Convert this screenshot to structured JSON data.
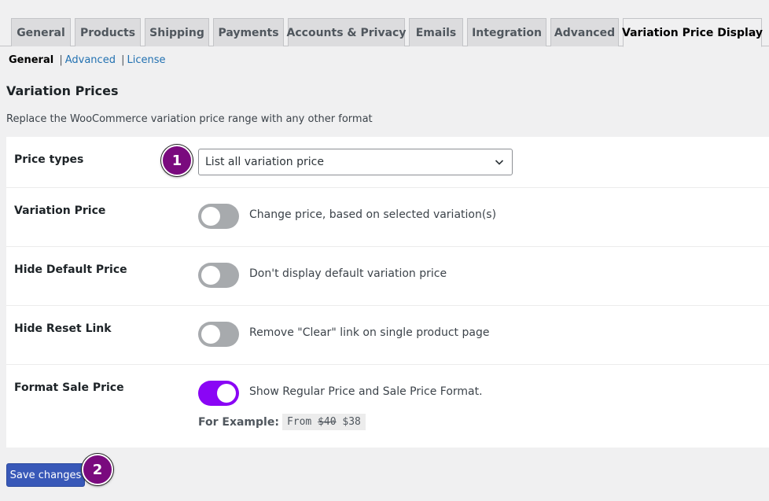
{
  "tabs": [
    {
      "label": "General"
    },
    {
      "label": "Products"
    },
    {
      "label": "Shipping"
    },
    {
      "label": "Payments"
    },
    {
      "label": "Accounts & Privacy"
    },
    {
      "label": "Emails"
    },
    {
      "label": "Integration"
    },
    {
      "label": "Advanced"
    },
    {
      "label": "Variation Price Display",
      "active": true
    }
  ],
  "subnav": {
    "current": "General",
    "sep": "|",
    "links": [
      "Advanced",
      "License"
    ]
  },
  "section": {
    "title": "Variation Prices",
    "description": "Replace the WooCommerce variation price range with any other format"
  },
  "settings": {
    "price_types": {
      "label": "Price types",
      "value": "List all variation price"
    },
    "variation_price": {
      "label": "Variation Price",
      "description": "Change price, based on selected variation(s)",
      "enabled": false
    },
    "hide_default_price": {
      "label": "Hide Default Price",
      "description": "Don't display default variation price",
      "enabled": false
    },
    "hide_reset_link": {
      "label": "Hide Reset Link",
      "description": "Remove \"Clear\" link on single product page",
      "enabled": false
    },
    "format_sale_price": {
      "label": "Format Sale Price",
      "description": "Show Regular Price and Sale Price Format.",
      "enabled": true,
      "example_label": "For Example:",
      "example_prefix": "From",
      "example_regular": "$40",
      "example_sale": "$38"
    }
  },
  "save_button": "Save changes",
  "markers": [
    "1",
    "2"
  ],
  "colors": {
    "toggle_on": "#8a05f5",
    "primary_button": "#3858b8",
    "marker": "#7a0a7e"
  }
}
